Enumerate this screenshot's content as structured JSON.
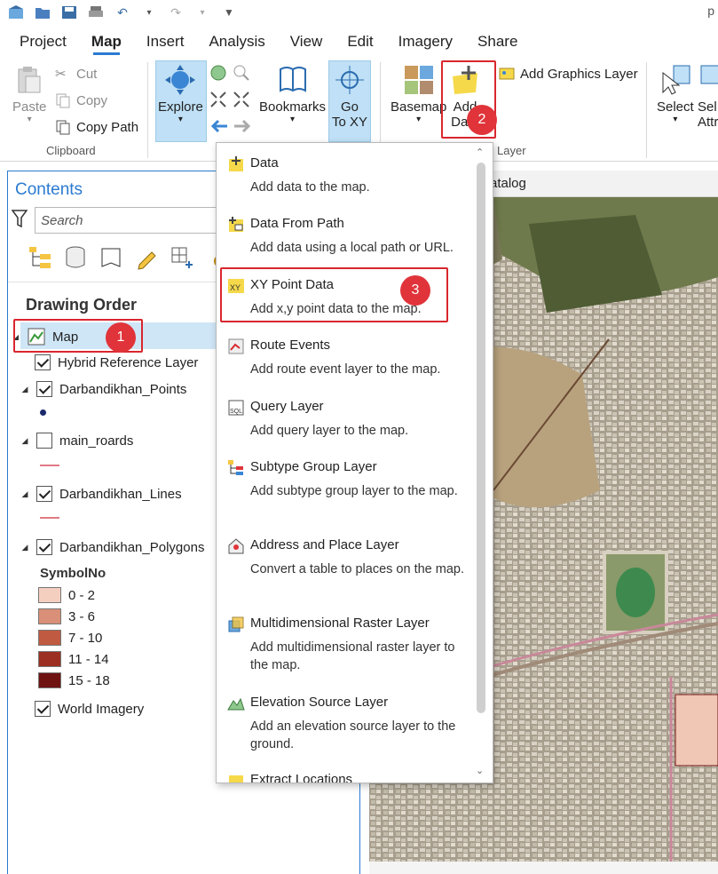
{
  "app": {
    "initial": "p"
  },
  "ribbon_tabs": [
    "Project",
    "Map",
    "Insert",
    "Analysis",
    "View",
    "Edit",
    "Imagery",
    "Share"
  ],
  "active_tab": "Map",
  "clipboard": {
    "paste": "Paste",
    "cut": "Cut",
    "copy": "Copy",
    "copy_path": "Copy Path",
    "group_label": "Clipboard"
  },
  "navigate": {
    "explore": "Explore",
    "bookmarks": "Bookmarks",
    "go_to": "Go",
    "go_to_line2": "To XY"
  },
  "layer_group": {
    "basemap": "Basemap",
    "add_data_line1": "Add",
    "add_data_line2": "Data",
    "add_graphics_layer": "Add Graphics Layer",
    "group_label": "Layer"
  },
  "selection": {
    "select": "Select",
    "select_by_attr_line1": "Sel",
    "select_by_attr_line2": "Attr"
  },
  "callouts": [
    "1",
    "2",
    "3"
  ],
  "contents": {
    "title": "Contents",
    "search_placeholder": "Search",
    "drawing_order": "Drawing Order",
    "map_label": "Map",
    "layers": [
      {
        "name": "Hybrid Reference Layer",
        "checked": true
      },
      {
        "name": "Darbandikhan_Points",
        "checked": true
      },
      {
        "name": "main_roards",
        "checked": false
      },
      {
        "name": "Darbandikhan_Lines",
        "checked": true
      },
      {
        "name": "Darbandikhan_Polygons",
        "checked": true
      },
      {
        "name": "World Imagery",
        "checked": true
      }
    ],
    "legend_field": "SymbolNo",
    "legend": [
      {
        "label": "0 - 2",
        "color": "#f4cfc0"
      },
      {
        "label": "3 - 6",
        "color": "#d98f78"
      },
      {
        "label": "7 - 10",
        "color": "#c05a40"
      },
      {
        "label": "11 - 14",
        "color": "#9c2f22"
      },
      {
        "label": "15 - 18",
        "color": "#6e1212"
      }
    ]
  },
  "map_view": {
    "tab_title": "atalog"
  },
  "add_data_menu": [
    {
      "title": "Data",
      "desc": "Add data to the map.",
      "icon": "add-data-icon"
    },
    {
      "title": "Data From Path",
      "desc": "Add data using a local path or URL.",
      "icon": "data-from-path-icon"
    },
    {
      "title": "XY Point Data",
      "desc": "Add x,y point data to the map.",
      "icon": "xy-point-data-icon"
    },
    {
      "title": "Route Events",
      "desc": "Add route event layer to the map.",
      "icon": "route-events-icon"
    },
    {
      "title": "Query Layer",
      "desc": "Add query layer to the map.",
      "icon": "query-layer-icon"
    },
    {
      "title": "Subtype Group Layer",
      "desc": "Add subtype group layer to the map.",
      "icon": "subtype-group-layer-icon"
    },
    {
      "title": "Address and Place Layer",
      "desc": "Convert a table to places on the map.",
      "icon": "address-place-layer-icon"
    },
    {
      "title": "Multidimensional Raster Layer",
      "desc": "Add multidimensional raster layer to the map.",
      "icon": "multidimensional-raster-icon"
    },
    {
      "title": "Elevation Source Layer",
      "desc": "Add an elevation source layer to the ground.",
      "icon": "elevation-source-icon"
    },
    {
      "title": "Extract Locations",
      "desc": "",
      "icon": "extract-locations-icon"
    }
  ],
  "colors": {
    "accent": "#2b7bd1",
    "callout_red": "#d9272e",
    "selected_bg": "#cfe6f7",
    "ribbon_highlight": "#bfe0f6"
  }
}
